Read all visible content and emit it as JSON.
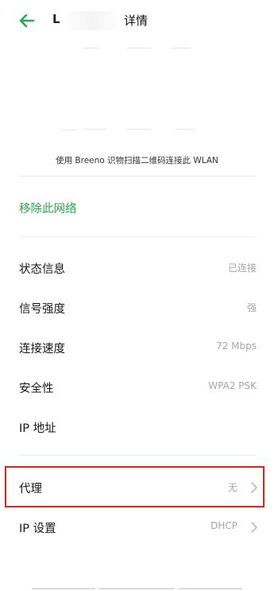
{
  "header": {
    "title_lead": "L",
    "title": "详情",
    "back_icon": "arrow-left-icon",
    "accent": "#2aa652"
  },
  "qr": {
    "caption": "使用 Breeno 识物扫描二维码连接此 WLAN"
  },
  "actions": {
    "remove_network": "移除此网络"
  },
  "rows": [
    {
      "label": "状态信息",
      "value": "已连接",
      "has_arrow": false
    },
    {
      "label": "信号强度",
      "value": "强",
      "has_arrow": false
    },
    {
      "label": "连接速度",
      "value": "72 Mbps",
      "has_arrow": false
    },
    {
      "label": "安全性",
      "value": "WPA2 PSK",
      "has_arrow": false
    },
    {
      "label": "IP 地址",
      "value": "",
      "has_arrow": false
    },
    {
      "label": "代理",
      "value": "无",
      "has_arrow": true
    },
    {
      "label": "IP 设置",
      "value": "DHCP",
      "has_arrow": true
    }
  ],
  "highlight": {
    "color": "#e0231f",
    "target": "代理"
  },
  "chevron_icon": "chevron-right-icon"
}
